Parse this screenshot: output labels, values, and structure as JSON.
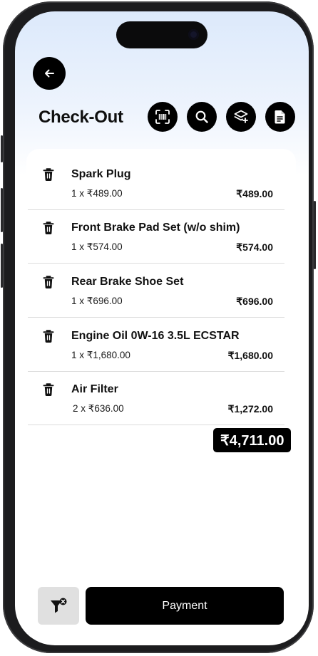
{
  "header": {
    "title": "Check-Out",
    "back_icon": "arrow-left-icon",
    "actions": [
      {
        "name": "scan-barcode",
        "icon": "barcode-scan-icon"
      },
      {
        "name": "search",
        "icon": "search-icon"
      },
      {
        "name": "add-layer",
        "icon": "layers-plus-icon"
      },
      {
        "name": "document",
        "icon": "document-icon"
      }
    ]
  },
  "cart": {
    "items": [
      {
        "name": "Spark Plug",
        "qty_price": "1 x ₹489.00",
        "total": "₹489.00"
      },
      {
        "name": "Front Brake Pad Set (w/o shim)",
        "qty_price": "1 x ₹574.00",
        "total": "₹574.00"
      },
      {
        "name": "Rear Brake Shoe Set",
        "qty_price": "1 x ₹696.00",
        "total": "₹696.00"
      },
      {
        "name": "Engine Oil 0W-16 3.5L ECSTAR",
        "qty_price": "1 x ₹1,680.00",
        "total": "₹1,680.00"
      },
      {
        "name": "Air Filter",
        "qty_price": "2 x ₹636.00",
        "total": "₹1,272.00"
      }
    ],
    "grand_total": "₹4,711.00"
  },
  "footer": {
    "clear_filter_icon": "filter-clear-icon",
    "payment_label": "Payment"
  },
  "colors": {
    "primary": "#000000",
    "background_top": "#dce9fb",
    "secondary_button": "#e0e0e0"
  }
}
